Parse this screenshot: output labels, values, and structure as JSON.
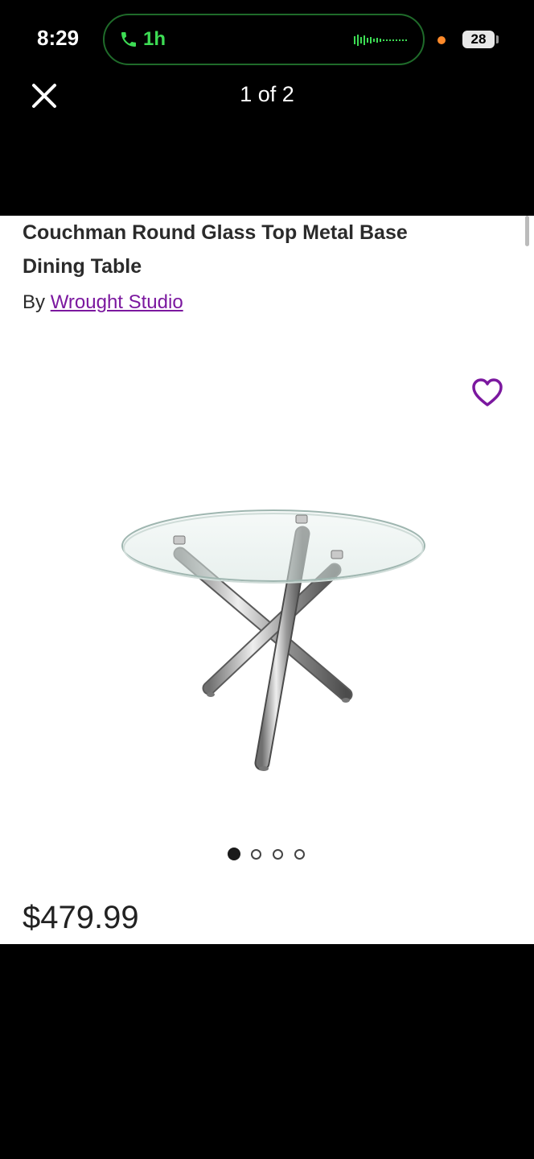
{
  "status_bar": {
    "time": "8:29",
    "call_duration": "1h",
    "battery": "28",
    "call_color": "#3ddc54",
    "indicator_color": "#ff8a2a"
  },
  "viewer": {
    "counter": "1 of 2",
    "close_icon": "close-icon"
  },
  "product": {
    "title": "Couchman Round Glass Top Metal Base Dining Table",
    "by_label": "By",
    "brand": "Wrought Studio",
    "brand_color": "#7b189f",
    "price": "$479.99",
    "favorite_icon": "heart-outline-icon"
  },
  "carousel": {
    "total": 4,
    "active_index": 0
  }
}
